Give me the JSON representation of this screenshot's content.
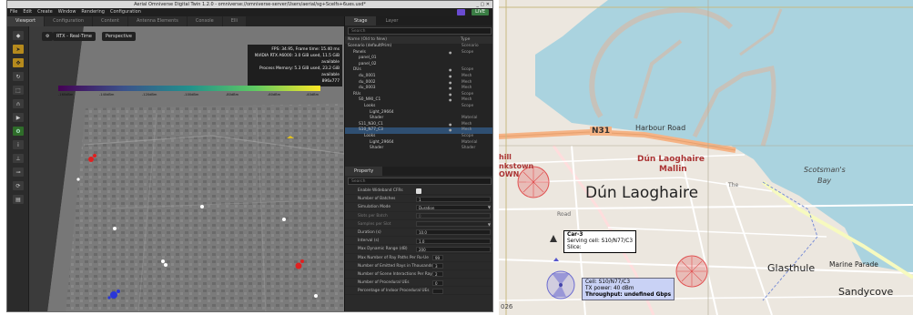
{
  "app": {
    "title": "Aerial Omniverse Digital Twin 1.2.0 - omniverse://omniverse-server/Users/aerial/sg+Scelfs+6ues.usd*",
    "menu": [
      "File",
      "Edit",
      "Create",
      "Window",
      "Rendering",
      "Configuration"
    ],
    "live_label": "LIVE",
    "window_buttons": "_ ▢ ✕"
  },
  "tabs": [
    {
      "label": "Viewport",
      "active": true
    },
    {
      "label": "Configuration",
      "active": false
    },
    {
      "label": "Content",
      "active": false
    },
    {
      "label": "Antenna Elements",
      "active": false
    },
    {
      "label": "Console",
      "active": false
    },
    {
      "label": "Elli",
      "active": false
    }
  ],
  "viewport": {
    "render_mode": "RTX - Real-Time",
    "camera": "Perspective",
    "hud": [
      "FPS: 34.95, Frame time: 15.40 ms",
      "NVIDIA RTX A6000: 3.0 GiB used, 11.5 GiB available",
      "Process Memory: 5.3 GiB used, 23.2 GiB available",
      "896x777"
    ],
    "colorbar_ticks": [
      "-160dBm",
      "-140dBm",
      "-120dBm",
      "-100dBm",
      "-80dBm",
      "-60dBm",
      "-40dBm"
    ]
  },
  "stage": {
    "tabs": [
      "Stage",
      "Layer"
    ],
    "search_placeholder": "Search",
    "columns": {
      "name": "Name (Old to New)",
      "type": "Type"
    },
    "rows": [
      {
        "name": "Scenario (defaultPrim)",
        "type": "Scenario",
        "indent": 0,
        "vis": false
      },
      {
        "name": "Panels",
        "type": "Scope",
        "indent": 1,
        "vis": true
      },
      {
        "name": "panel_01",
        "type": "",
        "indent": 2,
        "vis": false
      },
      {
        "name": "panel_02",
        "type": "",
        "indent": 2,
        "vis": false
      },
      {
        "name": "DUs",
        "type": "Scope",
        "indent": 1,
        "vis": true
      },
      {
        "name": "du_0001",
        "type": "Mesh",
        "indent": 2,
        "vis": true
      },
      {
        "name": "du_0002",
        "type": "Mesh",
        "indent": 2,
        "vis": true
      },
      {
        "name": "du_0003",
        "type": "Mesh",
        "indent": 2,
        "vis": true
      },
      {
        "name": "RUs",
        "type": "Scope",
        "indent": 1,
        "vis": true
      },
      {
        "name": "S0_N90_C1",
        "type": "Mesh",
        "indent": 2,
        "vis": true
      },
      {
        "name": "Looks",
        "type": "Scope",
        "indent": 3,
        "vis": false
      },
      {
        "name": "Light_29664",
        "type": "",
        "indent": 4,
        "vis": false
      },
      {
        "name": "Shader",
        "type": "Material",
        "indent": 4,
        "vis": false
      },
      {
        "name": "S11_N30_C1",
        "type": "Mesh",
        "indent": 2,
        "vis": true
      },
      {
        "name": "S10_N77_C3",
        "type": "Mesh",
        "indent": 2,
        "vis": true,
        "selected": true
      },
      {
        "name": "Looks",
        "type": "Scope",
        "indent": 3,
        "vis": false
      },
      {
        "name": "Light_29664",
        "type": "Material",
        "indent": 4,
        "vis": false
      },
      {
        "name": "Shader",
        "type": "Shader",
        "indent": 4,
        "vis": false
      }
    ]
  },
  "property": {
    "tab": "Property",
    "search_placeholder": "Search",
    "rows": [
      {
        "label": "Enable Wideband CFRs",
        "kind": "check"
      },
      {
        "label": "Number of Batches",
        "value": "1"
      },
      {
        "label": "Simulation Mode",
        "value": "Duration",
        "dropdown": true
      },
      {
        "label": "Slots per Batch",
        "value": "0",
        "dim": true
      },
      {
        "label": "Samples per Slot",
        "value": "",
        "dim": true,
        "dropdown": true
      },
      {
        "label": "Duration (s)",
        "value": "10.0"
      },
      {
        "label": "Interval (s)",
        "value": "1.0"
      },
      {
        "label": "Max Dynamic Range (dB)",
        "value": "200"
      },
      {
        "label": "Max Number of Ray Paths Per Ru-Ue",
        "value": "99",
        "narrow": true
      },
      {
        "label": "Number of Emitted Rays in Thousands",
        "value": "3",
        "narrow": true
      },
      {
        "label": "Number of Scene Interactions Per Ray",
        "value": "2",
        "narrow": true
      },
      {
        "label": "Number of Procedural UEs",
        "value": "0",
        "narrow": true
      },
      {
        "label": "Percentage of Indoor Procedural UEs",
        "value": "",
        "narrow": true
      }
    ]
  },
  "map": {
    "labels": {
      "harbour_road": "Harbour Road",
      "n31": "N31",
      "dun_laoghaire_mallin_1": "Dún Laoghaire",
      "dun_laoghaire_mallin_2": "Mallin",
      "dun_laoghaire": "Dún Laoghaire",
      "scotsmans_bay_1": "Scotsman's",
      "scotsmans_bay_2": "Bay",
      "glasthule": "Glasthule",
      "marine_parade": "Marine Parade",
      "sandycove": "Sandycove",
      "hill": "hill",
      "nkstown": "nkstown",
      "own": "OWN",
      "road": "Road",
      "tr": "The",
      "m26": "026"
    },
    "popup_car": {
      "title": "Car-3",
      "lines": [
        "Serving cell: S10/N77/C3",
        "Slice:"
      ]
    },
    "popup_cell": {
      "title": "Cell: S10/N77/C3",
      "lines": [
        "TX power: 40 dBm",
        "Throughput: undefined Gbps"
      ]
    },
    "colors": {
      "sea": "#aad3df",
      "land": "#ece7df",
      "primary_road": "#f5b385",
      "cell_ring": "#e05050"
    }
  }
}
